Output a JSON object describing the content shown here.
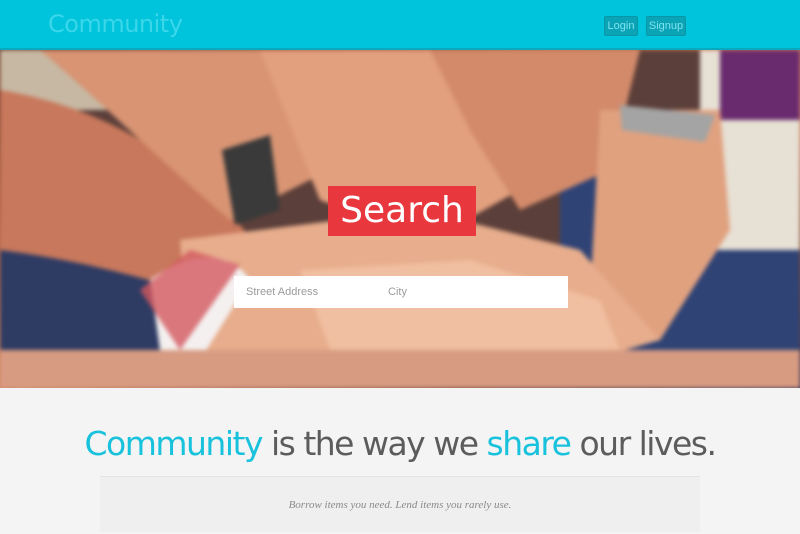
{
  "header": {
    "brand": "Community",
    "login_label": "Login",
    "signup_label": "Signup"
  },
  "hero": {
    "search_title": "Search",
    "street_placeholder": "Street Address",
    "city_placeholder": "City"
  },
  "intro": {
    "part1": "Community",
    "part2": " is the way we ",
    "part3": "share",
    "part4": " our lives.",
    "subtitle": "Borrow items you need. Lend items you rarely use."
  },
  "colors": {
    "header_bg": "#00c4dc",
    "search_accent": "#e8373d",
    "text_accent": "#19c2dc"
  }
}
